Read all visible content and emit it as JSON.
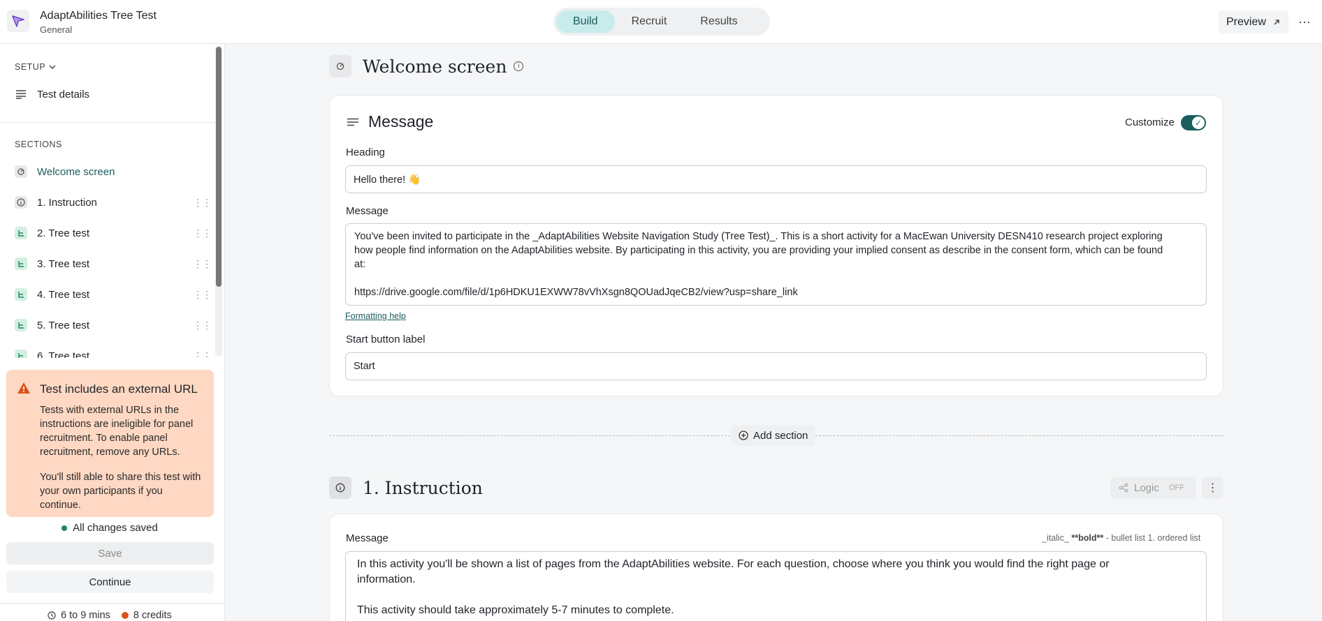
{
  "header": {
    "title": "AdaptAbilities Tree Test",
    "subtitle": "General",
    "tabs": [
      "Build",
      "Recruit",
      "Results"
    ],
    "active_tab": "Build",
    "preview_label": "Preview",
    "more_label": "···"
  },
  "sidebar": {
    "setup_label": "SETUP",
    "test_details": "Test details",
    "sections_label": "SECTIONS",
    "items": [
      {
        "label": "Welcome screen",
        "icon": "welcome-icon",
        "active": true
      },
      {
        "label": "1. Instruction",
        "icon": "info-icon"
      },
      {
        "label": "2. Tree test",
        "icon": "tree-icon"
      },
      {
        "label": "3. Tree test",
        "icon": "tree-icon"
      },
      {
        "label": "4. Tree test",
        "icon": "tree-icon"
      },
      {
        "label": "5. Tree test",
        "icon": "tree-icon"
      },
      {
        "label": "6. Tree test",
        "icon": "tree-icon"
      }
    ],
    "warning": {
      "title": "Test includes an external URL",
      "p1": "Tests with external URLs in the instructions are ineligible for panel recruitment. To enable panel recruitment, remove any URLs.",
      "p2": "You'll still able to share this test with your own participants if you continue."
    },
    "saved_status": "All changes saved",
    "save_label": "Save",
    "continue_label": "Continue",
    "duration": "6 to 9 mins",
    "credits": "8 credits"
  },
  "main": {
    "welcome": {
      "title": "Welcome screen",
      "card_title": "Message",
      "customize_label": "Customize",
      "heading_label": "Heading",
      "heading_value": "Hello there! 👋",
      "message_label": "Message",
      "message_line1": "You've been invited to participate in the _AdaptAbilities Website Navigation Study (Tree Test)_. This is a short activity for a MacEwan University DESN410 research project exploring",
      "message_line2": "how people find information on the AdaptAbilities website. By participating in this activity, you are providing your implied consent as describe in the consent form, which can be found",
      "message_line3": "at:",
      "message_line4": "https://drive.google.com/file/d/1p6HDKU1EXWW78vVhXsgn8QOUadJqeCB2/view?usp=share_link",
      "formatting_help": "Formatting help",
      "start_label": "Start button label",
      "start_value": "Start"
    },
    "add_section": "Add section",
    "instruction": {
      "title": "1. Instruction",
      "logic_label": "Logic",
      "logic_state": "OFF",
      "message_label": "Message",
      "format_hint_italic": "_italic_",
      "format_hint_bold": "**bold**",
      "format_hint_rest": "- bullet list 1. ordered list",
      "text_line1": "In this activity you'll be shown a list of pages from the AdaptAbilities website. For each question, choose where you think you would find the right page or",
      "text_line2": "information.",
      "text_line3": "This activity should take approximately 5-7 minutes to complete."
    }
  },
  "colors": {
    "accent": "#1a5d5d",
    "warning_bg": "#fed8c3",
    "credit_dot": "#d9531e"
  }
}
